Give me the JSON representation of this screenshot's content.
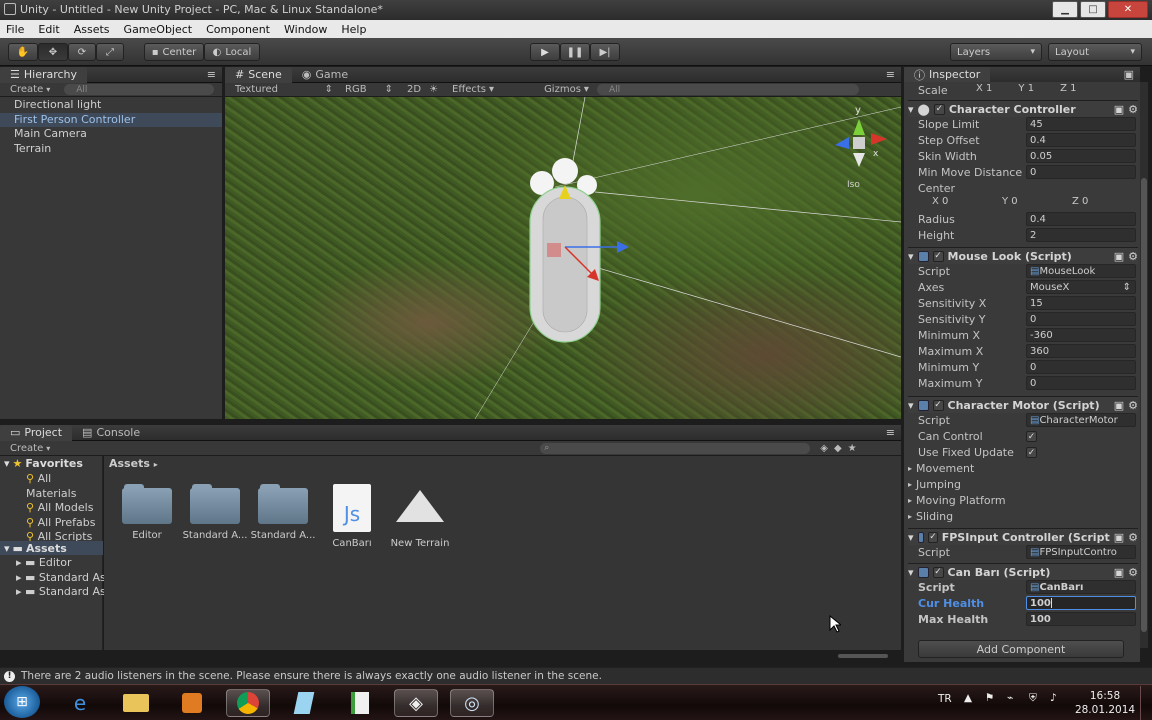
{
  "window": {
    "title": "Unity - Untitled - New Unity Project - PC, Mac & Linux Standalone*"
  },
  "menu": [
    "File",
    "Edit",
    "Assets",
    "GameObject",
    "Component",
    "Window",
    "Help"
  ],
  "toolbar": {
    "center_label": "Center",
    "local_label": "Local",
    "layers_label": "Layers",
    "layout_label": "Layout"
  },
  "hierarchy": {
    "tab": "Hierarchy",
    "create": "Create",
    "search_placeholder": "All",
    "items": [
      "Directional light",
      "First Person Controller",
      "Main Camera",
      "Terrain"
    ]
  },
  "scene": {
    "tab_scene": "Scene",
    "tab_game": "Game",
    "render_mode": "Textured",
    "color_mode": "RGB",
    "mode_2d": "2D",
    "effects": "Effects",
    "gizmos": "Gizmos",
    "search_placeholder": "All",
    "gizmo_x": "x",
    "gizmo_y": "y",
    "iso": "Iso"
  },
  "project": {
    "tab_project": "Project",
    "tab_console": "Console",
    "create": "Create",
    "favorites_title": "Favorites",
    "favorites": [
      "All Materials",
      "All Models",
      "All Prefabs",
      "All Scripts"
    ],
    "assets_title": "Assets",
    "asset_folders": [
      "Editor",
      "Standard As",
      "Standard As"
    ],
    "breadcrumb": "Assets",
    "assets": [
      "Editor",
      "Standard A...",
      "Standard A...",
      "CanBarı",
      "New Terrain"
    ]
  },
  "inspector": {
    "tab": "Inspector",
    "scale": {
      "label": "Scale",
      "x": "1",
      "y": "1",
      "z": "1"
    },
    "character_controller": {
      "title": "Character Controller",
      "slope_limit": "45",
      "step_offset": "0.4",
      "skin_width": "0.05",
      "min_move_distance": "0",
      "center_x": "0",
      "center_y": "0",
      "center_z": "0",
      "radius": "0.4",
      "height": "2",
      "labels": {
        "slope_limit": "Slope Limit",
        "step_offset": "Step Offset",
        "skin_width": "Skin Width",
        "min_move_distance": "Min Move Distance",
        "center": "Center",
        "radius": "Radius",
        "height": "Height"
      }
    },
    "mouse_look": {
      "title": "Mouse Look (Script)",
      "script": "MouseLook",
      "axes": "MouseX",
      "sens_x": "15",
      "sens_y": "0",
      "min_x": "-360",
      "max_x": "360",
      "min_y": "0",
      "max_y": "0",
      "labels": {
        "script": "Script",
        "axes": "Axes",
        "sens_x": "Sensitivity X",
        "sens_y": "Sensitivity Y",
        "min_x": "Minimum X",
        "max_x": "Maximum X",
        "min_y": "Minimum Y",
        "max_y": "Maximum Y"
      }
    },
    "character_motor": {
      "title": "Character Motor (Script)",
      "script": "CharacterMotor",
      "labels": {
        "script": "Script",
        "can_control": "Can Control",
        "use_fixed_update": "Use Fixed Update"
      },
      "foldouts": [
        "Movement",
        "Jumping",
        "Moving Platform",
        "Sliding"
      ]
    },
    "fps_input": {
      "title": "FPSInput Controller (Script",
      "script_label": "Script",
      "script": "FPSInputContro"
    },
    "can_bari": {
      "title": "Can Barı (Script)",
      "script_label": "Script",
      "script": "CanBarı",
      "cur_health_label": "Cur Health",
      "cur_health": "100",
      "max_health_label": "Max Health",
      "max_health": "100"
    },
    "add_component": "Add Component"
  },
  "status": {
    "message": "There are 2 audio listeners in the scene. Please ensure there is always exactly one audio listener in the scene."
  },
  "taskbar": {
    "lang": "TR",
    "time": "16:58",
    "date": "28.01.2014"
  },
  "colors": {
    "accent_blue": "#4f8fe6",
    "selection_bg": "#3e4a5a",
    "close_red": "#c7453c"
  }
}
